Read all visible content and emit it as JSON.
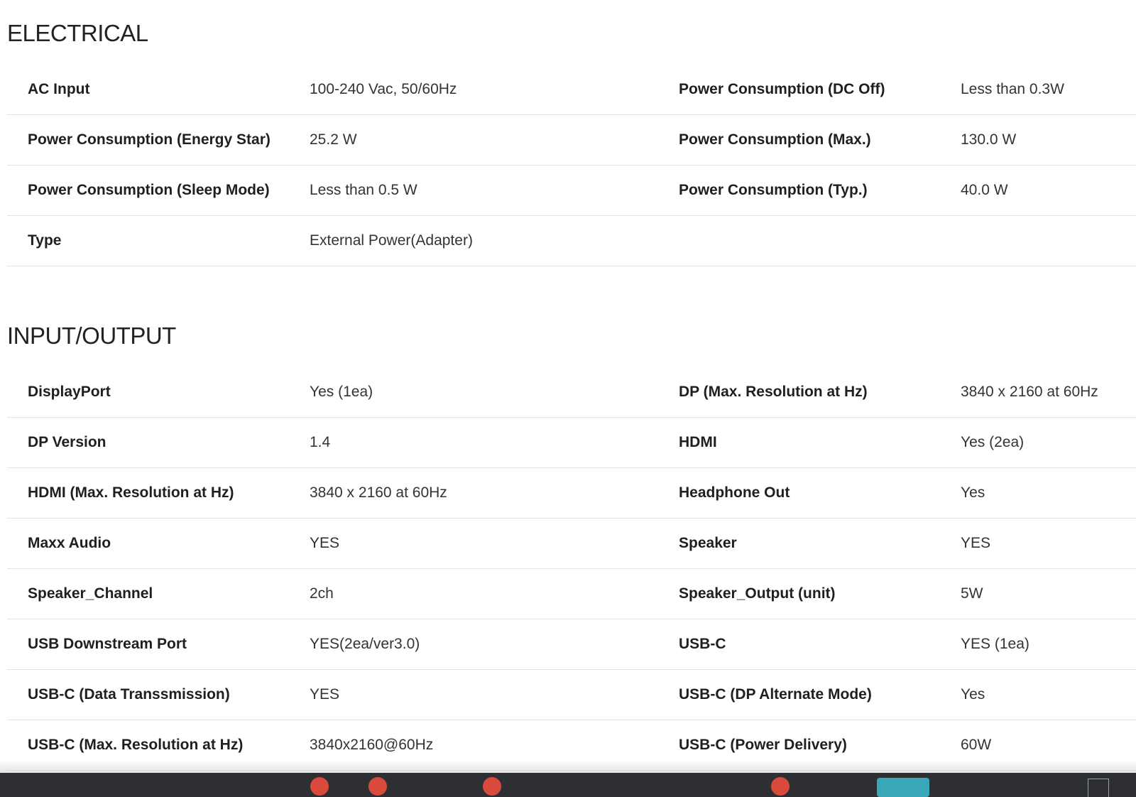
{
  "sections": {
    "electrical": {
      "title": "ELECTRICAL",
      "rows": [
        {
          "l1": "AC Input",
          "v1": "100-240 Vac, 50/60Hz",
          "l2": "Power Consumption (DC Off)",
          "v2": "Less than 0.3W"
        },
        {
          "l1": "Power Consumption (Energy Star)",
          "v1": "25.2 W",
          "l2": "Power Consumption (Max.)",
          "v2": "130.0 W"
        },
        {
          "l1": "Power Consumption (Sleep Mode)",
          "v1": "Less than 0.5 W",
          "l2": "Power Consumption (Typ.)",
          "v2": "40.0 W"
        },
        {
          "l1": "Type",
          "v1": "External Power(Adapter)",
          "l2": "",
          "v2": ""
        }
      ]
    },
    "input_output": {
      "title": "INPUT/OUTPUT",
      "rows": [
        {
          "l1": "DisplayPort",
          "v1": "Yes (1ea)",
          "l2": "DP (Max. Resolution at Hz)",
          "v2": "3840 x 2160 at 60Hz"
        },
        {
          "l1": "DP Version",
          "v1": "1.4",
          "l2": "HDMI",
          "v2": "Yes (2ea)"
        },
        {
          "l1": "HDMI (Max. Resolution at Hz)",
          "v1": "3840 x 2160 at 60Hz",
          "l2": "Headphone Out",
          "v2": "Yes"
        },
        {
          "l1": "Maxx Audio",
          "v1": "YES",
          "l2": "Speaker",
          "v2": "YES"
        },
        {
          "l1": "Speaker_Channel",
          "v1": "2ch",
          "l2": "Speaker_Output (unit)",
          "v2": "5W"
        },
        {
          "l1": "USB Downstream Port",
          "v1": "YES(2ea/ver3.0)",
          "l2": "USB-C",
          "v2": "YES (1ea)"
        },
        {
          "l1": "USB-C (Data Transsmission)",
          "v1": "YES",
          "l2": "USB-C (DP Alternate Mode)",
          "v2": "Yes"
        },
        {
          "l1": "USB-C (Max. Resolution at Hz)",
          "v1": "3840x2160@60Hz",
          "l2": "USB-C (Power Delivery)",
          "v2": "60W"
        }
      ]
    }
  },
  "colors": {
    "text": "#1a1a1a",
    "row_divider": "#e3e3e3",
    "taskbar": "#2d2f33",
    "dock_red": "#d94a3d",
    "dock_teal": "#3aa7b8"
  }
}
